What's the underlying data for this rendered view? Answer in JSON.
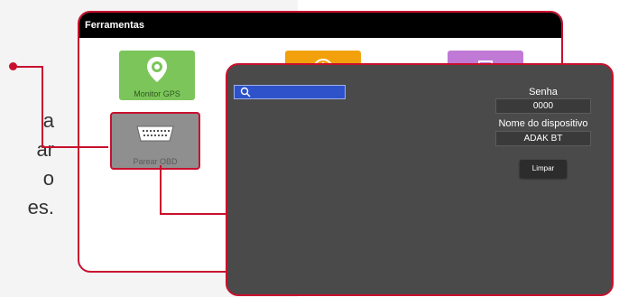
{
  "side_text": [
    "a",
    "ar",
    "o",
    "es."
  ],
  "back_window": {
    "title": "Ferramentas",
    "tiles": [
      {
        "label": "Monitor GPS",
        "icon": "map-pin-icon"
      },
      {
        "label": "",
        "icon": "orange-app-icon"
      },
      {
        "label": "",
        "icon": "purple-app-icon"
      },
      {
        "label": "Parear OBD",
        "icon": "obd-connector-icon"
      }
    ]
  },
  "front_window": {
    "search_value": "",
    "senha_label": "Senha",
    "senha_value": "0000",
    "device_label": "Nome do dispositivo",
    "device_value": "ADAK BT",
    "clear_button": "Limpar"
  },
  "colors": {
    "accent": "#c8102e",
    "front_bg": "#4a4a4a",
    "search_bg": "#2d52c9",
    "gps_tile": "#7cc55a",
    "orange_tile": "#f2a10c",
    "purple_tile": "#c07ad6"
  }
}
